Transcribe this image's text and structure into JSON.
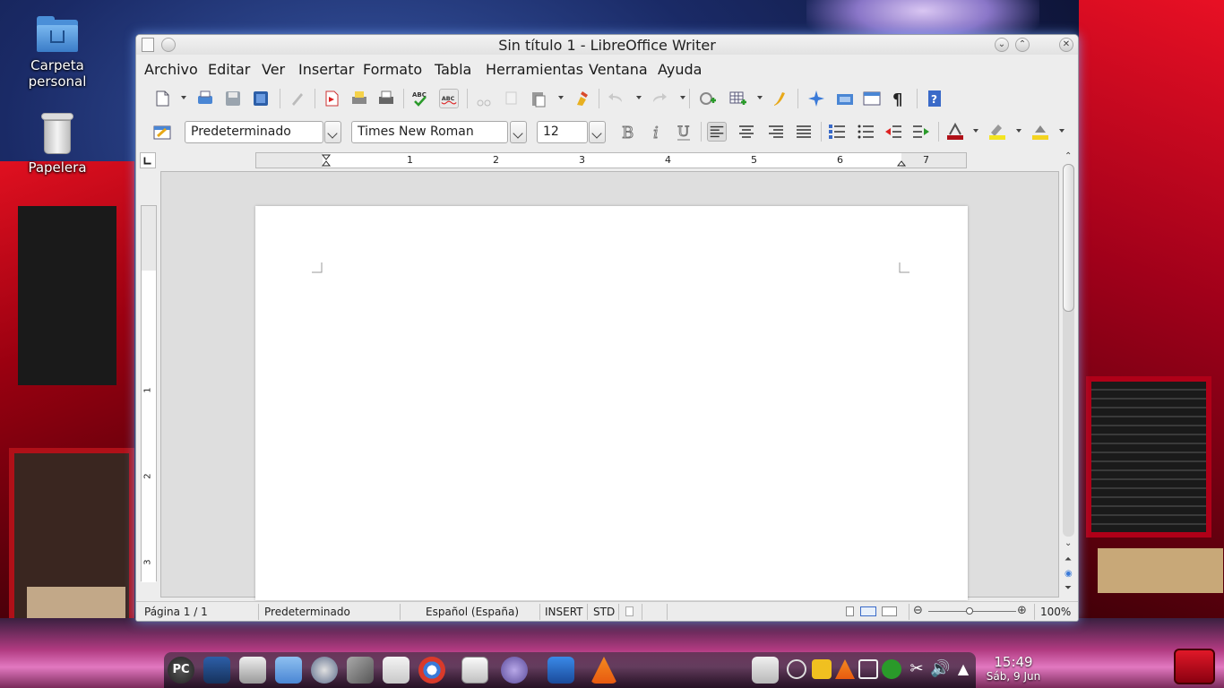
{
  "desktop": {
    "icons": [
      {
        "label_line1": "Carpeta",
        "label_line2": "personal",
        "icon": "home-folder-icon"
      },
      {
        "label_line1": "Papelera",
        "label_line2": "",
        "icon": "trash-icon"
      }
    ]
  },
  "window": {
    "title": "Sin título 1 - LibreOffice Writer",
    "menu": [
      "Archivo",
      "Editar",
      "Ver",
      "Insertar",
      "Formato",
      "Tabla",
      "Herramientas",
      "Ventana",
      "Ayuda"
    ]
  },
  "format_toolbar": {
    "paragraph_style": "Predeterminado",
    "font_name": "Times New Roman",
    "font_size": "12"
  },
  "ruler": {
    "h_numbers": [
      "1",
      "2",
      "3",
      "4",
      "5",
      "6",
      "7"
    ],
    "v_numbers": [
      "1",
      "2",
      "3"
    ]
  },
  "statusbar": {
    "page": "Página  1 / 1",
    "page_style": "Predeterminado",
    "language": "Español (España)",
    "insert_mode": "INSERT",
    "selection_mode": "STD",
    "zoom": "100%"
  },
  "taskbar": {
    "pc_label": "PC",
    "clock_time": "15:49",
    "clock_date": "Sáb, 9 Jun"
  },
  "colors": {
    "window_bg": "#ededed",
    "accent_glow": "#78aaff",
    "doc_bg": "#dedede"
  }
}
